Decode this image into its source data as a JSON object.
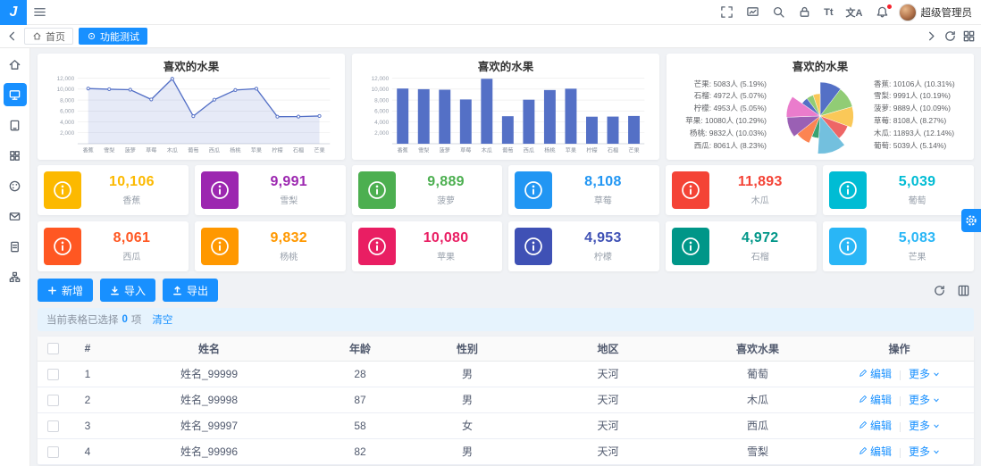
{
  "app": {
    "logo_text": "J",
    "username": "超级管理员"
  },
  "icons": {
    "font_size": "Tt",
    "translate": "文A"
  },
  "tabs": {
    "home": "首页",
    "active": "功能测试"
  },
  "chart_data": [
    {
      "type": "line",
      "title": "喜欢的水果",
      "categories": [
        "香蕉",
        "雪梨",
        "菠萝",
        "草莓",
        "木瓜",
        "葡萄",
        "西瓜",
        "杨桃",
        "苹果",
        "柠檬",
        "石榴",
        "芒果"
      ],
      "values": [
        10106,
        9991,
        9889,
        8108,
        11893,
        5039,
        8061,
        9832,
        10080,
        4953,
        4972,
        5083
      ],
      "ylim": [
        0,
        12000
      ],
      "ytick_step": 2000,
      "grid": true,
      "area": true,
      "color": "#5470c6"
    },
    {
      "type": "bar",
      "title": "喜欢的水果",
      "categories": [
        "香蕉",
        "雪梨",
        "菠萝",
        "草莓",
        "木瓜",
        "葡萄",
        "西瓜",
        "杨桃",
        "苹果",
        "柠檬",
        "石榴",
        "芒果"
      ],
      "values": [
        10106,
        9991,
        9889,
        8108,
        11893,
        5039,
        8061,
        9832,
        10080,
        4953,
        4972,
        5083
      ],
      "ylim": [
        0,
        12000
      ],
      "ytick_step": 2000,
      "grid": true,
      "color": "#5470c6"
    },
    {
      "type": "pie",
      "subtype": "rose",
      "title": "喜欢的水果",
      "labels": [
        "香蕉",
        "雪梨",
        "菠萝",
        "草莓",
        "木瓜",
        "葡萄",
        "西瓜",
        "杨桃",
        "苹果",
        "柠檬",
        "石榴",
        "芒果"
      ],
      "values": [
        10106,
        9991,
        9889,
        8108,
        11893,
        5039,
        8061,
        9832,
        10080,
        4953,
        4972,
        5083
      ],
      "label_left": [
        "芒果: 5083人 (5.19%)",
        "石榴: 4972人 (5.07%)",
        "柠檬: 4953人 (5.05%)",
        "苹果: 10080人 (10.29%)",
        "杨桃: 9832人 (10.03%)",
        "西瓜: 8061人 (8.23%)"
      ],
      "label_right": [
        "香蕉: 10106人 (10.31%)",
        "雪梨: 9991人 (10.19%)",
        "菠萝: 9889人 (10.09%)",
        "草莓: 8108人 (8.27%)",
        "木瓜: 11893人 (12.14%)",
        "葡萄: 5039人 (5.14%)"
      ],
      "palette": [
        "#5470c6",
        "#91cc75",
        "#fac858",
        "#ee6666",
        "#73c0de",
        "#3ba272",
        "#fc8452",
        "#9a60b4",
        "#ea7ccc",
        "#5470c6",
        "#91cc75",
        "#fac858"
      ]
    }
  ],
  "cards": [
    {
      "label": "香蕉",
      "value": "10,106",
      "color": "#fcb900"
    },
    {
      "label": "雪梨",
      "value": "9,991",
      "color": "#9c27b0"
    },
    {
      "label": "菠萝",
      "value": "9,889",
      "color": "#4caf50"
    },
    {
      "label": "草莓",
      "value": "8,108",
      "color": "#2196f3"
    },
    {
      "label": "木瓜",
      "value": "11,893",
      "color": "#f44336"
    },
    {
      "label": "葡萄",
      "value": "5,039",
      "color": "#00bcd4"
    },
    {
      "label": "西瓜",
      "value": "8,061",
      "color": "#ff5722"
    },
    {
      "label": "杨桃",
      "value": "9,832",
      "color": "#ff9800"
    },
    {
      "label": "苹果",
      "value": "10,080",
      "color": "#e91e63"
    },
    {
      "label": "柠檬",
      "value": "4,953",
      "color": "#3f51b5"
    },
    {
      "label": "石榴",
      "value": "4,972",
      "color": "#009688"
    },
    {
      "label": "芒果",
      "value": "5,083",
      "color": "#29b6f6"
    }
  ],
  "toolbar": {
    "add": "新增",
    "import": "导入",
    "export": "导出"
  },
  "selection": {
    "prefix": "当前表格已选择",
    "count": "0",
    "suffix": "项",
    "clear": "清空"
  },
  "table": {
    "headers": [
      "#",
      "姓名",
      "年龄",
      "性别",
      "地区",
      "喜欢水果",
      "操作"
    ],
    "edit_label": "编辑",
    "more_label": "更多",
    "rows": [
      {
        "cells": [
          "1",
          "姓名_99999",
          "28",
          "男",
          "天河",
          "葡萄"
        ]
      },
      {
        "cells": [
          "2",
          "姓名_99998",
          "87",
          "男",
          "天河",
          "木瓜"
        ]
      },
      {
        "cells": [
          "3",
          "姓名_99997",
          "58",
          "女",
          "天河",
          "西瓜"
        ]
      },
      {
        "cells": [
          "4",
          "姓名_99996",
          "82",
          "男",
          "天河",
          "雪梨"
        ]
      }
    ]
  },
  "colors": {
    "primary": "#1890ff",
    "series": "#5470c6"
  }
}
